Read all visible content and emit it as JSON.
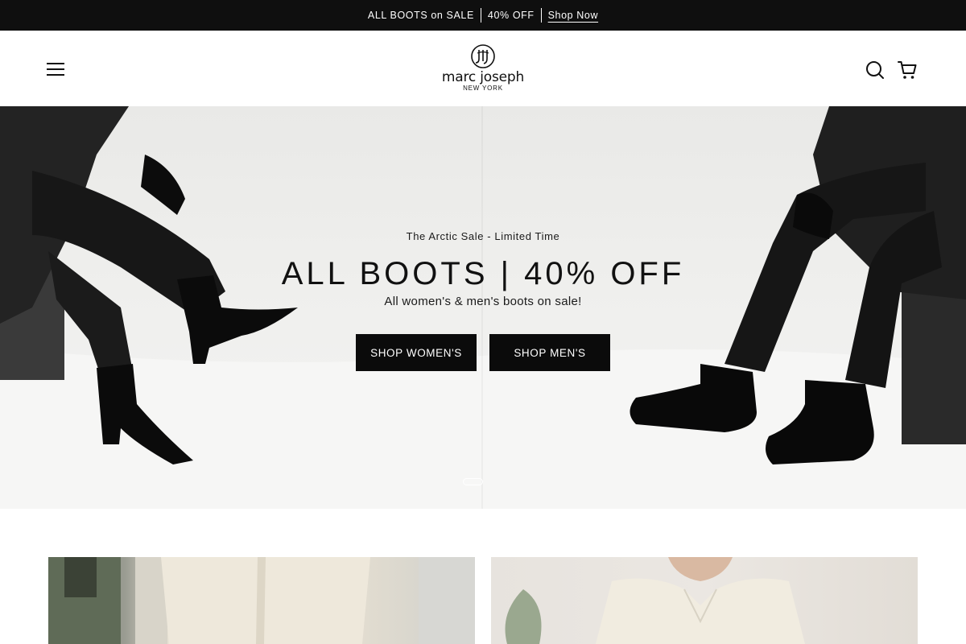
{
  "announcement": {
    "segments": [
      "ALL BOOTS on SALE",
      "40% OFF"
    ],
    "link_label": "Shop Now"
  },
  "header": {
    "brand_name": "marc joseph",
    "brand_sub": "NEW YORK",
    "icons": [
      "menu-icon",
      "search-icon",
      "cart-icon"
    ]
  },
  "hero": {
    "kicker": "The Arctic Sale - Limited Time",
    "headline": "ALL BOOTS | 40% OFF",
    "subhead": "All women's & men's boots on sale!",
    "buttons": {
      "women": "SHOP WOMEN'S",
      "men": "SHOP MEN'S"
    },
    "slides_total": 1,
    "active_slide": 1
  },
  "colors": {
    "announcement_bg": "#0f0f0f",
    "cta_bg": "#0b0b0b",
    "text": "#111111"
  }
}
